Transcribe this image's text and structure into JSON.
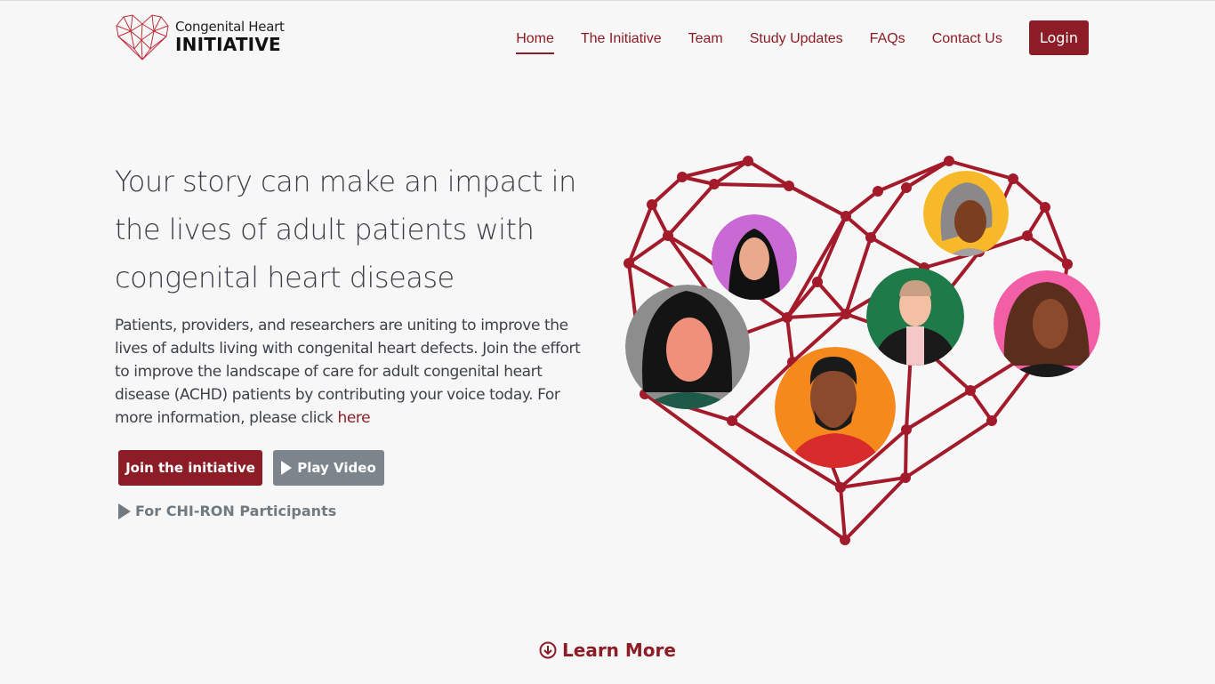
{
  "brand": {
    "name_top": "Congenital Heart",
    "name_bottom": "INITIATIVE",
    "logo_icon": "heart-network-icon",
    "accent_color": "#8c1d26"
  },
  "nav": {
    "items": [
      {
        "label": "Home",
        "active": true
      },
      {
        "label": "The Initiative",
        "active": false
      },
      {
        "label": "Team",
        "active": false
      },
      {
        "label": "Study Updates",
        "active": false
      },
      {
        "label": "FAQs",
        "active": false
      },
      {
        "label": "Contact Us",
        "active": false
      }
    ],
    "login_label": "Login"
  },
  "hero": {
    "title": "Your story can make an impact in the lives of adult patients with congenital heart disease",
    "body": "Patients, providers, and researchers are uniting to improve the lives of adults living with congenital heart defects. Join the effort to improve the landscape of care for adult congenital heart disease (ACHD) patients by contributing your voice today. For more information, please click ",
    "body_link": "here",
    "join_button": "Join the initiative",
    "video_button": "Play Video",
    "chiron_link": "For CHI-RON Participants"
  },
  "illustration": {
    "icon": "heart-network-illustration",
    "people_colors": [
      "#c869d4",
      "#f7b92a",
      "#1f7a4a",
      "#f25fa6",
      "#8d8d8d",
      "#f5891c"
    ]
  },
  "footer_cta": {
    "learn_more": "Learn More",
    "icon": "circle-down-arrow-icon"
  }
}
